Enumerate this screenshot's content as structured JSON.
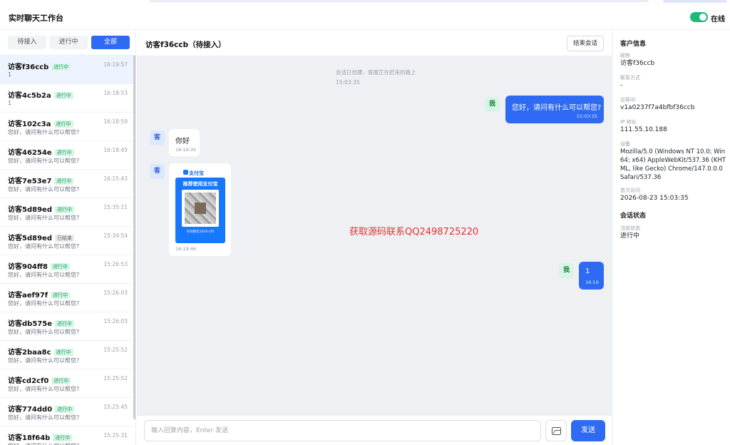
{
  "app": {
    "title": "实时聊天工作台",
    "status_label": "在线"
  },
  "filters": [
    {
      "label": "待接入"
    },
    {
      "label": "进行中"
    },
    {
      "label": "全部"
    }
  ],
  "conversations": [
    {
      "name": "访客f36ccb",
      "status": "进行中",
      "time": "16:19:57",
      "preview": "1"
    },
    {
      "name": "访客4c5b2a",
      "status": "进行中",
      "time": "16:18:53",
      "preview": "1"
    },
    {
      "name": "访客102c3a",
      "status": "进行中",
      "time": "16:18:59",
      "preview": "您好，请问有什么可以帮您?"
    },
    {
      "name": "访客46254e",
      "status": "进行中",
      "time": "16:18:45",
      "preview": "您好，请问有什么可以帮您?"
    },
    {
      "name": "访客7e53e7",
      "status": "进行中",
      "time": "16:15:43",
      "preview": "您好，请问有什么可以帮您?"
    },
    {
      "name": "访客5d89ed",
      "status": "进行中",
      "time": "15:35:11",
      "preview": "您好，请问有什么可以帮您?"
    },
    {
      "name": "访客5d89ed",
      "status": "已结束",
      "time": "15:34:54",
      "preview": "您好，请问有什么可以帮您?"
    },
    {
      "name": "访客904ff8",
      "status": "进行中",
      "time": "15:26:53",
      "preview": "您好，请问有什么可以帮您?"
    },
    {
      "name": "访客aef97f",
      "status": "进行中",
      "time": "15:26:03",
      "preview": "您好，请问有什么可以帮您?"
    },
    {
      "name": "访客db575e",
      "status": "进行中",
      "time": "15:26:03",
      "preview": "您好，请问有什么可以帮您?"
    },
    {
      "name": "访客2baa8c",
      "status": "进行中",
      "time": "15:25:52",
      "preview": "您好，请问有什么可以帮您?"
    },
    {
      "name": "访客cd2cf0",
      "status": "进行中",
      "time": "15:25:52",
      "preview": "您好，请问有什么可以帮您?"
    },
    {
      "name": "访客774dd0",
      "status": "进行中",
      "time": "15:25:45",
      "preview": "您好，请问有什么可以帮您?"
    },
    {
      "name": "访客18f64b",
      "status": "进行中",
      "time": "15:25:31",
      "preview": "您好，请问有什么可以帮您?"
    }
  ],
  "chat": {
    "title": "访客f36ccb（待接入）",
    "end_button": "结束会话",
    "system_message": "会话已创建，客服正在赶来的路上",
    "system_time": "15:03:35",
    "messages": [
      {
        "avatar": "我",
        "text": "您好，请问有什么可以帮您?",
        "time": "15:03:35"
      },
      {
        "avatar": "客",
        "text": "你好",
        "time": "16:19:35"
      },
      {
        "avatar": "客",
        "qr_brand": "支付宝",
        "qr_banner": "推荐使用支付宝",
        "qr_caption": "有效期至2026-4月",
        "time": "16:19:46"
      },
      {
        "avatar": "我",
        "text": "1",
        "time": "16:19"
      }
    ],
    "watermark": "获取源码联系QQ2498725220",
    "input_placeholder": "输入回复内容，Enter 发送",
    "send_button": "发送"
  },
  "customer": {
    "section_title": "客户信息",
    "fields": [
      {
        "label": "昵称",
        "value": "访客f36ccb"
      },
      {
        "label": "联系方式",
        "value": "-"
      },
      {
        "label": "访客ID",
        "value": "v1a0237f7a4bfbf36ccb"
      },
      {
        "label": "IP 地址",
        "value": "111.55.10.188"
      },
      {
        "label": "设备",
        "value": "Mozilla/5.0 (Windows NT 10.0; Win64; x64) AppleWebKit/537.36 (KHTML, like Gecko) Chrome/147.0.0.0 Safari/537.36"
      },
      {
        "label": "首次访问",
        "value": "2026-08-23 15:03:35"
      }
    ],
    "session_section": "会话状态",
    "session_label": "当前状态",
    "session_value": "进行中"
  }
}
